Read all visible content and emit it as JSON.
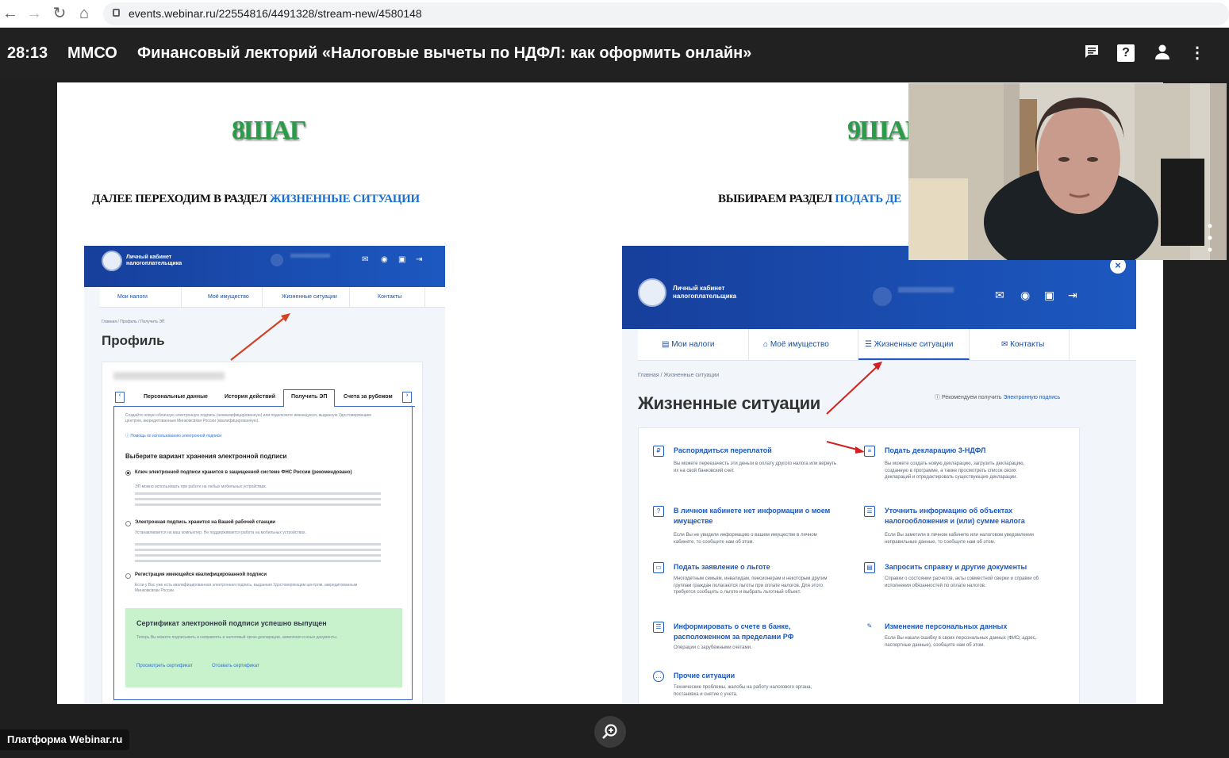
{
  "browser": {
    "url": "events.webinar.ru/22554816/4491328/stream-new/4580148",
    "nav_icons": [
      "back-arrow-icon",
      "forward-arrow-icon",
      "reload-icon",
      "home-icon"
    ]
  },
  "topbar": {
    "timer": "28:13",
    "org": "ММСО",
    "title": "Финансовый лекторий «Налоговые вычеты по НДФЛ: как оформить онлайн»",
    "icons": [
      "chat-icon",
      "help-icon",
      "user-icon",
      "more-vertical-icon"
    ]
  },
  "slide": {
    "left": {
      "step": "8ШАГ",
      "subtitle_prefix": "ДАЛЕЕ ПЕРЕХОДИМ В РАЗДЕЛ ",
      "subtitle_link": "ЖИЗНЕННЫЕ СИТУАЦИИ",
      "header": {
        "title_line1": "Личный кабинет",
        "title_line2": "налогоплательщика"
      },
      "nav": [
        "Мои налоги",
        "Моё имущество",
        "Жизненные ситуации",
        "Контакты"
      ],
      "crumb": "Главная / Профиль / Получить ЭП",
      "page_title": "Профиль",
      "tabs": [
        "Персональные данные",
        "История действий",
        "Получить ЭП",
        "Счета за рубежом"
      ],
      "intro": "Создайте новую облачную электронную подпись (неквалифицированную) или подключите имеющуюся, выданную Удостоверяющим центром, аккредитованным Минкомсвязи России (квалифицированную).",
      "help_link": "Помощь по использованию электронной подписи",
      "section_title": "Выберите вариант хранения электронной подписи",
      "options": [
        {
          "title": "Ключ электронной подписи хранится в защищенной системе ФНС России (рекомендовано)",
          "text": "ЭП можно использовать при работе на любых мобильных устройствах."
        },
        {
          "title": "Электронная подпись хранится на Вашей рабочей станции",
          "text": "Устанавливается на ваш компьютер. Не поддерживается работа на мобильных устройствах."
        },
        {
          "title": "Регистрация имеющейся квалифицированной подписи",
          "text": "Если у Вас уже есть квалифицированная электронная подпись, выданная Удостоверяющим центром, аккредитованным Минкомсвязи России."
        }
      ],
      "cert_title": "Сертификат электронной подписи успешно выпущен",
      "cert_note": "Теперь Вы можете подписывать и направлять в налоговый орган декларации, заявления и иные документы.",
      "cert_links": [
        "Просмотреть сертификат",
        "Отозвать сертификат"
      ]
    },
    "right": {
      "step": "9ШАГ",
      "subtitle_prefix": "ВЫБИРАЕМ РАЗДЕЛ ",
      "subtitle_link": "ПОДАТЬ ДЕ",
      "header": {
        "title_line1": "Личный кабинет",
        "title_line2": "налогоплательщика"
      },
      "nav": [
        "Мои налоги",
        "Моё имущество",
        "Жизненные ситуации",
        "Контакты"
      ],
      "crumb": "Главная / Жизненные ситуации",
      "page_title": "Жизненные ситуации",
      "hint_prefix": "Рекомендуем получить ",
      "hint_link": "Электронную подпись",
      "situations": [
        {
          "title": "Распорядиться переплатой",
          "text": "Вы можете переезачесть эти деньги в оплату другого налога или вернуть их на свой банковский счет."
        },
        {
          "title": "Подать декларацию 3-НДФЛ",
          "text": "Вы можете создать новую декларацию, загрузить декларацию, созданную в программе, а также просмотреть список своих деклараций и отредактировать существующие декларации."
        },
        {
          "title": "В личном кабинете нет информации о моем имуществе",
          "text": "Если Вы не увидели информацию о вашем имуществе в личном кабинете, то сообщите нам об этом."
        },
        {
          "title": "Уточнить информацию об объектах налогообложения и (или) сумме налога",
          "text": "Если Вы заметили в личном кабинете или налоговом уведомлении неправильные данные, то сообщите нам об этом."
        },
        {
          "title": "Подать заявление о льготе",
          "text": "Многодетным семьям, инвалидам, пенсионерам и некоторым другим группам граждан полагаются льготы при оплате налогов. Для этого требуется сообщить о льготе и выбрать льготный объект."
        },
        {
          "title": "Запросить справку и другие документы",
          "text": "Справки о состоянии расчетов, акты совместной сверки и справки об исполнении обязанностей по оплате налогов."
        },
        {
          "title": "Информировать о счете в банке, расположенном за пределами РФ",
          "text": "Операции с зарубежными счетами."
        },
        {
          "title": "Изменение персональных данных",
          "text": "Если Вы нашли ошибку в своих персональных данных (ФИО, адрес, паспортные данные), сообщите нам об этом."
        },
        {
          "title": "Прочие ситуации",
          "text": "Технические проблемы, жалобы на работу налогового органа, постановка и снятие с учета."
        }
      ]
    }
  },
  "footer": {
    "platform": "Платформа Webinar.ru",
    "zoom_icon": "zoom-in-icon"
  },
  "colors": {
    "topbar": "#212121",
    "step_green": "#2a9b48",
    "link_blue": "#1a6fcf",
    "nalog_blue": "#1c58c0"
  }
}
